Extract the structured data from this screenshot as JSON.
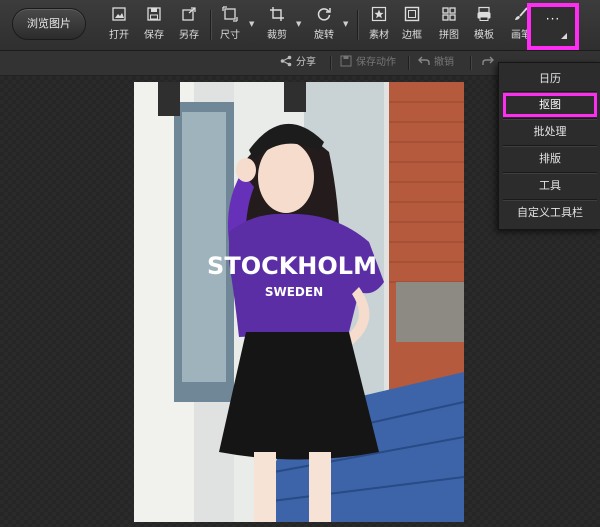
{
  "toolbar": {
    "browse_label": "浏览图片",
    "items": [
      {
        "label": "打开",
        "icon": "open-image-icon"
      },
      {
        "label": "保存",
        "icon": "save-icon"
      },
      {
        "label": "另存",
        "icon": "save-as-icon"
      },
      {
        "label": "尺寸",
        "icon": "resize-icon"
      },
      {
        "label": "裁剪",
        "icon": "crop-icon"
      },
      {
        "label": "旋转",
        "icon": "rotate-icon"
      },
      {
        "label": "素材",
        "icon": "star-icon"
      },
      {
        "label": "边框",
        "icon": "frame-icon"
      },
      {
        "label": "拼图",
        "icon": "grid-icon"
      },
      {
        "label": "模板",
        "icon": "template-icon"
      },
      {
        "label": "画笔",
        "icon": "brush-icon"
      }
    ],
    "more_label": "···"
  },
  "subbar": {
    "share": "分享",
    "save_action": "保存动作",
    "undo": "撤销"
  },
  "dropdown": {
    "items": [
      "日历",
      "抠图",
      "批处理",
      "排版",
      "工具",
      "自定义工具栏"
    ],
    "highlighted": "抠图"
  },
  "photo": {
    "shirt_text_main": "STOCKHOLM",
    "shirt_text_sub": "SWEDEN"
  },
  "colors": {
    "highlight": "#ff2df1",
    "shirt": "#5b2ea6"
  }
}
